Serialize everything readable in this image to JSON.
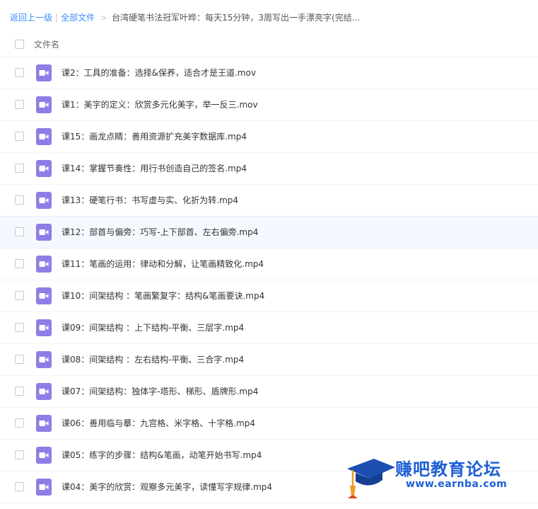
{
  "breadcrumb": {
    "back": "返回上一级",
    "divider": "|",
    "all_files": "全部文件",
    "arrow": ">",
    "current": "台湾硬笔书法冠军叶晔：每天15分钟，3周写出一手漂亮字(完结..."
  },
  "list_header": {
    "column_filename": "文件名"
  },
  "files": [
    {
      "name": "课2：工具的准备：选择&保养，适合才是王道.mov"
    },
    {
      "name": "课1：美字的定义：欣赏多元化美字，举一反三.mov"
    },
    {
      "name": "课15：画龙点睛：善用资源扩充美字数据库.mp4"
    },
    {
      "name": "课14：掌握节奏性：用行书创造自己的签名.mp4"
    },
    {
      "name": "课13：硬笔行书：书写虚与实、化折为转.mp4"
    },
    {
      "name": "课12：部首与偏旁：巧写-上下部首、左右偏旁.mp4"
    },
    {
      "name": "课11：笔画的运用：律动和分解，让笔画精致化.mp4"
    },
    {
      "name": "课10：间架结构 ：笔画繁复字：结构&笔画要诀.mp4"
    },
    {
      "name": "课09：间架结构 ：上下结构-平衡、三层字.mp4"
    },
    {
      "name": "课08：间架结构 ：左右结构-平衡、三合字.mp4"
    },
    {
      "name": "课07：间架结构：独体字-塔形、梯形、盾牌形.mp4"
    },
    {
      "name": "课06：善用临与摹：九宫格、米字格、十字格.mp4"
    },
    {
      "name": "课05：练字的步骤：结构&笔画，动笔开始书写.mp4"
    },
    {
      "name": "课04：美字的欣赏：观察多元美字，读懂写字规律.mp4"
    }
  ],
  "active_row_index": 5,
  "icon_name": "video-file-icon",
  "colors": {
    "link": "#3b8cff",
    "video_icon": "#8f7de6",
    "active_row": "#f4f8ff",
    "watermark": "#1d5fd6"
  },
  "watermark": {
    "title": "赚吧教育论坛",
    "url": "www.earnba.com"
  }
}
